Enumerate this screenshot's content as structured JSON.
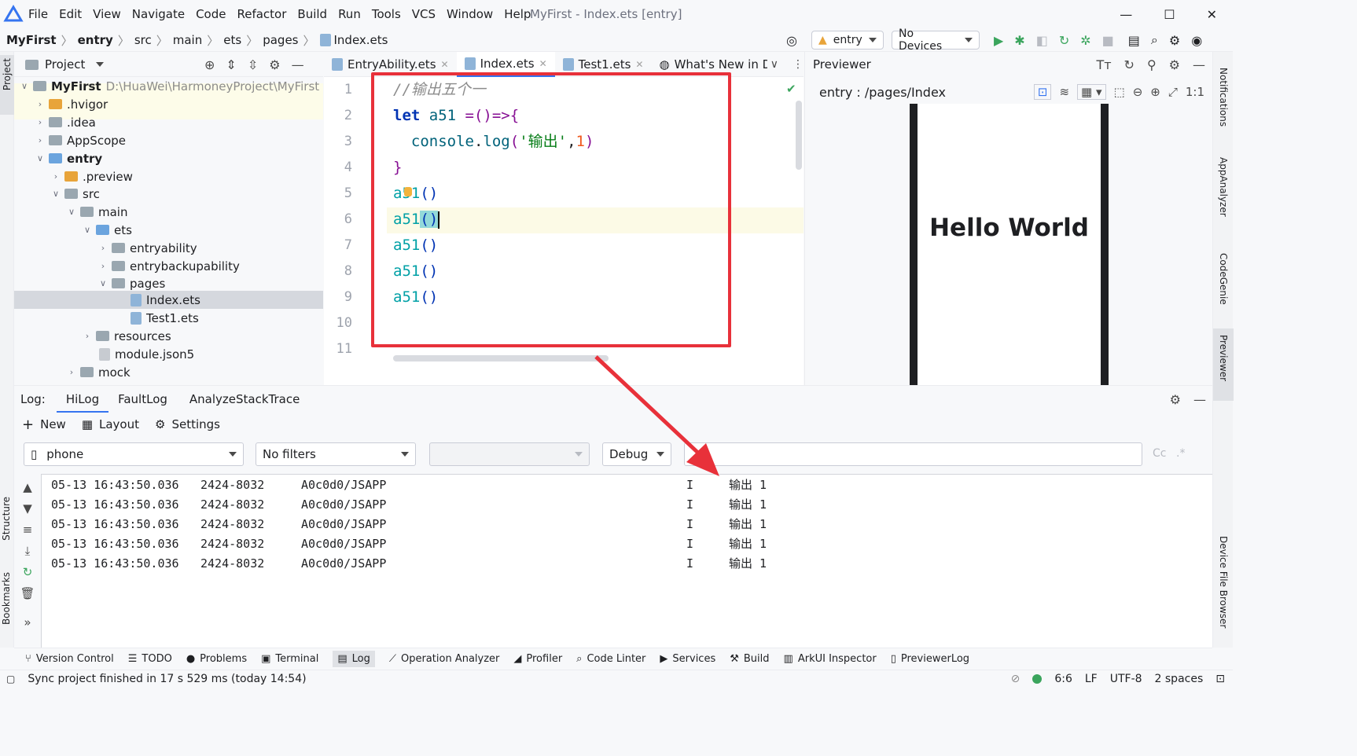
{
  "menu": {
    "items": [
      "File",
      "Edit",
      "View",
      "Navigate",
      "Code",
      "Refactor",
      "Build",
      "Run",
      "Tools",
      "VCS",
      "Window",
      "Help"
    ],
    "window_title": "MyFirst - Index.ets [entry]"
  },
  "breadcrumb": {
    "items": [
      "MyFirst",
      "entry",
      "src",
      "main",
      "ets",
      "pages",
      "Index.ets"
    ]
  },
  "toolbar": {
    "module": "entry",
    "device": "No Devices"
  },
  "project": {
    "header": "Project",
    "root_name": "MyFirst",
    "root_path": "D:\\HuaWei\\HarmoneyProject\\MyFirst",
    "tree": [
      ".hvigor",
      ".idea",
      "AppScope",
      "entry",
      ".preview",
      "src",
      "main",
      "ets",
      "entryability",
      "entrybackupability",
      "pages",
      "Index.ets",
      "Test1.ets",
      "resources",
      "module.json5",
      "mock"
    ]
  },
  "left_strip": {
    "project": "Project",
    "structure": "Structure",
    "bookmarks": "Bookmarks"
  },
  "right_strip": {
    "notifications": "Notifications",
    "appanalyzer": "AppAnalyzer",
    "codegenie": "CodeGenie",
    "previewer": "Previewer",
    "device_file_browser": "Device File Browser"
  },
  "editor": {
    "tabs": [
      "EntryAbility.ets",
      "Index.ets",
      "Test1.ets",
      "What's New in Dev"
    ],
    "line_numbers": [
      "1",
      "2",
      "3",
      "4",
      "5",
      "6",
      "7",
      "8",
      "9",
      "10",
      "11"
    ],
    "code": {
      "comment": "//输出五个一",
      "l2_kw": "let",
      "l2_name": " a51",
      "l2_rest": " =()=>{",
      "l3_obj": "  console",
      "l3_dot": ".",
      "l3_fn": "log",
      "l3_open": "(",
      "l3_str": "'输出'",
      "l3_comma": ",",
      "l3_num": "1",
      "l3_close": ")",
      "l4": "}",
      "call_name": "a51",
      "call_parens": "()"
    }
  },
  "previewer": {
    "title": "Previewer",
    "path": "entry : /pages/Index",
    "hello": "Hello World"
  },
  "log": {
    "label": "Log:",
    "tabs": [
      "HiLog",
      "FaultLog",
      "AnalyzeStackTrace"
    ],
    "tools": {
      "new": "New",
      "layout": "Layout",
      "settings": "Settings"
    },
    "device": "phone",
    "filter": "No filters",
    "level": "Debug",
    "case_label": "Cc",
    "regex_label": ".*",
    "rows": [
      {
        "time": "05-13 16:43:50.036",
        "pid": "2424-8032",
        "tag": "A0c0d0/JSAPP",
        "lvl": "I",
        "msg": "输出 1"
      },
      {
        "time": "05-13 16:43:50.036",
        "pid": "2424-8032",
        "tag": "A0c0d0/JSAPP",
        "lvl": "I",
        "msg": "输出 1"
      },
      {
        "time": "05-13 16:43:50.036",
        "pid": "2424-8032",
        "tag": "A0c0d0/JSAPP",
        "lvl": "I",
        "msg": "输出 1"
      },
      {
        "time": "05-13 16:43:50.036",
        "pid": "2424-8032",
        "tag": "A0c0d0/JSAPP",
        "lvl": "I",
        "msg": "输出 1"
      },
      {
        "time": "05-13 16:43:50.036",
        "pid": "2424-8032",
        "tag": "A0c0d0/JSAPP",
        "lvl": "I",
        "msg": "输出 1"
      }
    ]
  },
  "tool_windows": [
    "Version Control",
    "TODO",
    "Problems",
    "Terminal",
    "Log",
    "Operation Analyzer",
    "Profiler",
    "Code Linter",
    "Services",
    "Build",
    "ArkUI Inspector",
    "PreviewerLog"
  ],
  "status": {
    "message": "Sync project finished in 17 s 529 ms (today 14:54)",
    "position": "6:6",
    "line_sep": "LF",
    "encoding": "UTF-8",
    "indent": "2 spaces"
  },
  "colors": {
    "annotation": "#e8313a",
    "accent": "#3574f0",
    "run": "#3ba55d"
  }
}
